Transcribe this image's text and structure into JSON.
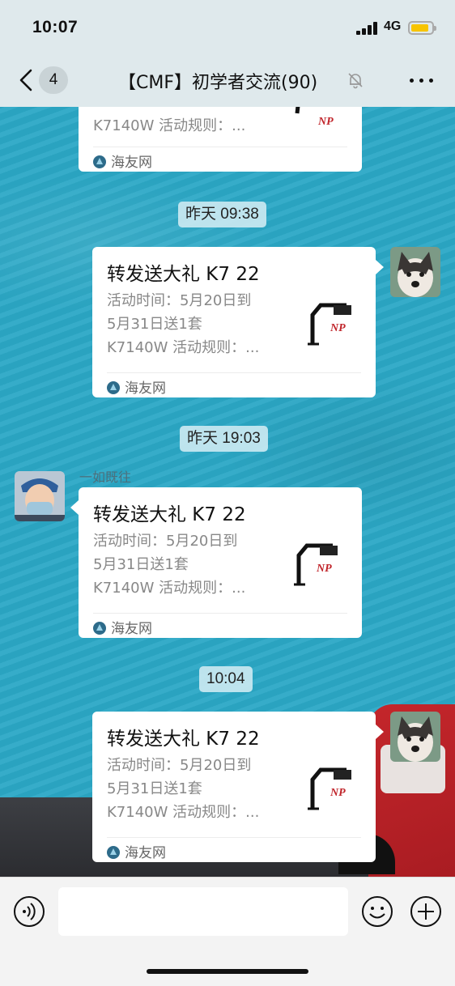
{
  "status_bar": {
    "time": "10:07",
    "network": "4G"
  },
  "nav": {
    "back_badge": "4",
    "title": "【CMF】初学者交流(90)"
  },
  "messages": [
    {
      "type": "card",
      "from": "other",
      "desc_lines": [
        "K7140W 活动规则：..."
      ],
      "source": "海友网"
    },
    {
      "type": "time",
      "text": "昨天 09:38"
    },
    {
      "type": "card",
      "from": "self",
      "title": "转发送大礼 K7 22",
      "desc_lines": [
        "活动时间：5月20日到",
        "5月31日送1套",
        "K7140W 活动规则：..."
      ],
      "source": "海友网"
    },
    {
      "type": "time",
      "text": "昨天 19:03"
    },
    {
      "type": "card",
      "from": "other",
      "sender": "一如既往",
      "title": "转发送大礼 K7 22",
      "desc_lines": [
        "活动时间：5月20日到",
        "5月31日送1套",
        "K7140W 活动规则：..."
      ],
      "source": "海友网"
    },
    {
      "type": "time",
      "text": "10:04"
    },
    {
      "type": "card",
      "from": "self",
      "title": "转发送大礼 K7 22",
      "desc_lines": [
        "活动时间：5月20日到",
        "5月31日送1套",
        "K7140W 活动规则：..."
      ],
      "source": "海友网"
    }
  ],
  "thumb_logo_text": "NP",
  "icons": {
    "back": "chevron-left-icon",
    "mute": "bell-off-icon",
    "more": "more-dots-icon",
    "voice": "voice-icon",
    "emoji": "emoji-icon",
    "plus": "plus-icon"
  },
  "colors": {
    "chat_bg": "#2ba8c6",
    "topbar_bg": "#dfe9ec",
    "battery": "#f7c400"
  }
}
